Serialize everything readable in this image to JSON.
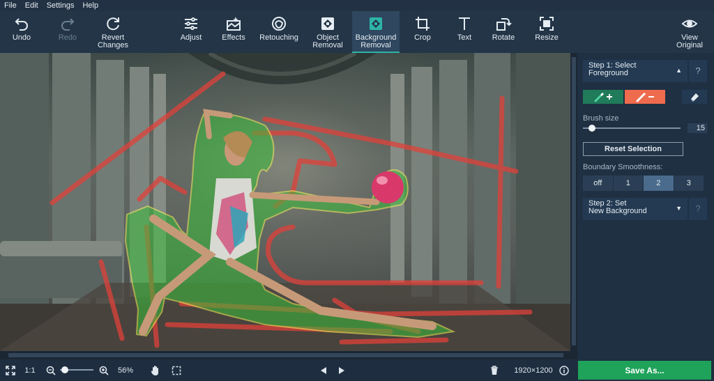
{
  "menu": {
    "file": "File",
    "edit": "Edit",
    "settings": "Settings",
    "help": "Help"
  },
  "toolbar": {
    "undo": "Undo",
    "redo": "Redo",
    "revert": "Revert\nChanges",
    "adjust": "Adjust",
    "effects": "Effects",
    "retouching": "Retouching",
    "object_removal": "Object\nRemoval",
    "background_removal": "Background\nRemoval",
    "crop": "Crop",
    "text": "Text",
    "rotate": "Rotate",
    "resize": "Resize",
    "view_original": "View\nOriginal"
  },
  "panel": {
    "step1": "Step 1: Select\nForeground",
    "step1_help": "?",
    "brush_size_label": "Brush size",
    "brush_size_value": "15",
    "reset_selection": "Reset Selection",
    "boundary_label": "Boundary Smoothness:",
    "smoothness_options": [
      "off",
      "1",
      "2",
      "3"
    ],
    "smoothness_selected": "2",
    "step2": "Step 2: Set\nNew Background",
    "step2_help": "?"
  },
  "bottom": {
    "ratio": "1:1",
    "zoom": "56%",
    "dimensions": "1920×1200",
    "save": "Save As..."
  },
  "colors": {
    "accent_teal": "#2fb3a8",
    "foreground_brush": "#1f7b5a",
    "background_brush": "#ef6b4e",
    "save_green": "#1fa35a",
    "foreground_mark": "#3bbf3b",
    "background_mark": "#e0413a"
  },
  "icons": [
    "undo-icon",
    "redo-icon",
    "revert-icon",
    "adjust-icon",
    "effects-icon",
    "retouching-icon",
    "object-removal-icon",
    "background-removal-icon",
    "crop-icon",
    "text-icon",
    "rotate-icon",
    "resize-icon",
    "eye-icon",
    "eraser-icon",
    "fullscreen-icon",
    "zoom-out-icon",
    "zoom-in-icon",
    "hand-icon",
    "select-icon",
    "prev-icon",
    "next-icon",
    "trash-icon",
    "info-icon"
  ]
}
